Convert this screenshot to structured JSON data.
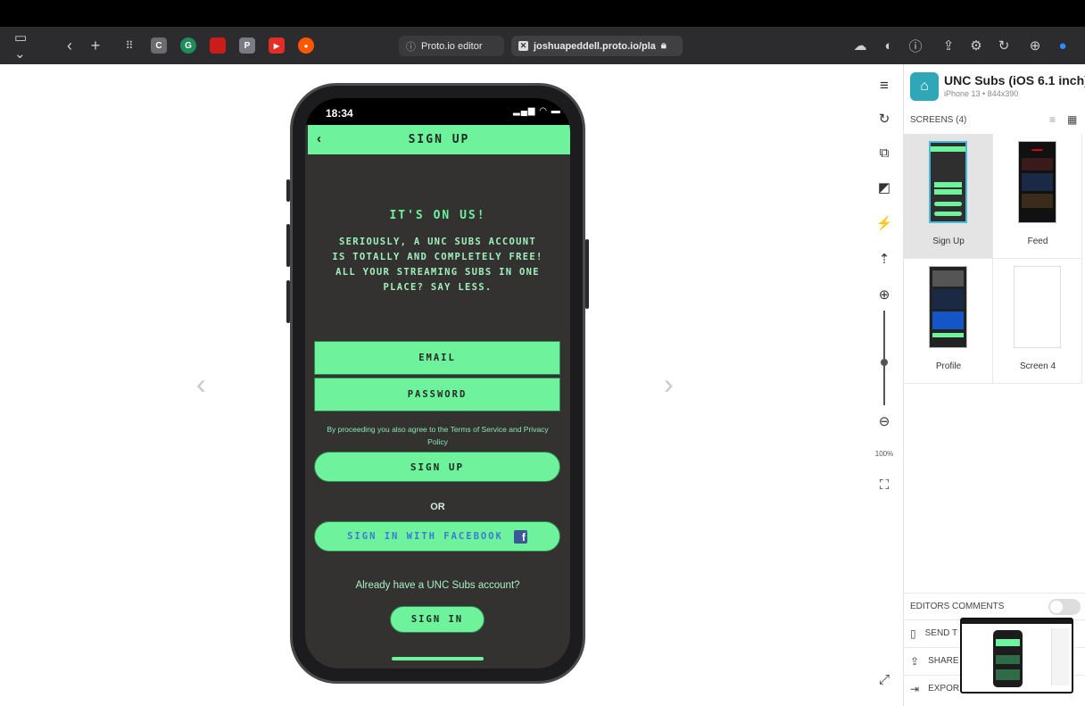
{
  "browser": {
    "tabs": [
      {
        "label": "Proto.io editor"
      },
      {
        "label": "joshuapeddell.proto.io/pla"
      }
    ],
    "favicons": [
      "C",
      "G",
      "",
      "P",
      "▶",
      "●"
    ]
  },
  "phone": {
    "time": "18:34",
    "nav_title": "SIGN UP",
    "headline": "IT'S ON US!",
    "paragraph": "SERIOUSLY, A UNC SUBS ACCOUNT IS TOTALLY AND COMPLETELY FREE! ALL YOUR STREAMING SUBS IN ONE PLACE? SAY LESS.",
    "email_placeholder": "EMAIL",
    "password_placeholder": "PASSWORD",
    "terms": "By proceeding you also agree to the Terms of Service and Privacy Policy",
    "signup_label": "SIGN UP",
    "or_label": "OR",
    "facebook_label": "SIGN IN WITH FACEBOOK",
    "already_label": "Already have a UNC Subs account?",
    "signin_label": "SIGN IN"
  },
  "toolbar": {
    "zoom_label": "100%"
  },
  "panel": {
    "project_title": "UNC Subs (iOS 6.1 inch)",
    "project_sub": "iPhone 13 • 844x390",
    "screens_header": "SCREENS (4)",
    "screens": [
      {
        "label": "Sign Up"
      },
      {
        "label": "Feed"
      },
      {
        "label": "Profile"
      },
      {
        "label": "Screen 4"
      }
    ],
    "editors_comments": "EDITORS COMMENTS",
    "send_label": "SEND T",
    "share_label": "SHARE",
    "export_label": "EXPOR"
  },
  "colors": {
    "accent_green": "#6ef29b",
    "screen_bg": "#343131",
    "facebook_blue": "#3b5998"
  }
}
